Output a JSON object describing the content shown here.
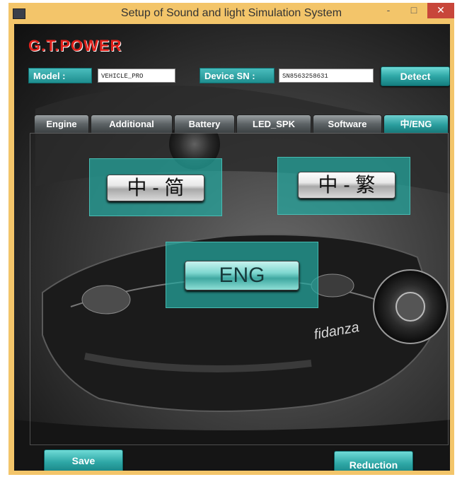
{
  "window": {
    "title": "Setup of Sound and light Simulation System",
    "minimize_glyph": "-",
    "maximize_glyph": "□",
    "close_glyph": "✕"
  },
  "logo": {
    "text": "G.T.POWER"
  },
  "model": {
    "label": "Model :",
    "value": "VEHICLE_PRO"
  },
  "device": {
    "label": "Device SN :",
    "value": "SN8563258631",
    "detect_label": "Detect"
  },
  "tabs": [
    {
      "label": "Engine",
      "active": false
    },
    {
      "label": "Additional",
      "active": false
    },
    {
      "label": "Battery",
      "active": false
    },
    {
      "label": "LED_SPK",
      "active": false
    },
    {
      "label": "Software",
      "active": false
    },
    {
      "label": "中/ENG",
      "active": true
    }
  ],
  "language": {
    "zh_simplified": "中 - 简",
    "zh_traditional": "中 - 繁",
    "english": "ENG"
  },
  "background": {
    "car_text": "fidanza"
  },
  "footer": {
    "save_label": "Save",
    "reduction_label": "Reduction"
  },
  "colors": {
    "accent": "#2aa3a1",
    "titlebar": "#f3c56a",
    "logo": "#e0201a"
  }
}
